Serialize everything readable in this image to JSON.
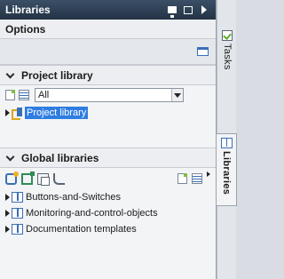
{
  "panel": {
    "title": "Libraries",
    "options_label": "Options"
  },
  "project_library": {
    "header": "Project library",
    "filter_value": "All",
    "items": [
      {
        "label": "Project library",
        "selected": true
      }
    ]
  },
  "global_libraries": {
    "header": "Global libraries",
    "items": [
      {
        "label": "Buttons-and-Switches"
      },
      {
        "label": "Monitoring-and-control-objects"
      },
      {
        "label": "Documentation templates"
      }
    ]
  },
  "side_tabs": [
    {
      "label": "Tasks",
      "icon": "tasks-icon"
    },
    {
      "label": "Libraries",
      "icon": "library-icon"
    }
  ],
  "colors": {
    "titlebar": "#2a3b50",
    "selection": "#2f7de1",
    "library_icon": "#3a6fb4"
  }
}
